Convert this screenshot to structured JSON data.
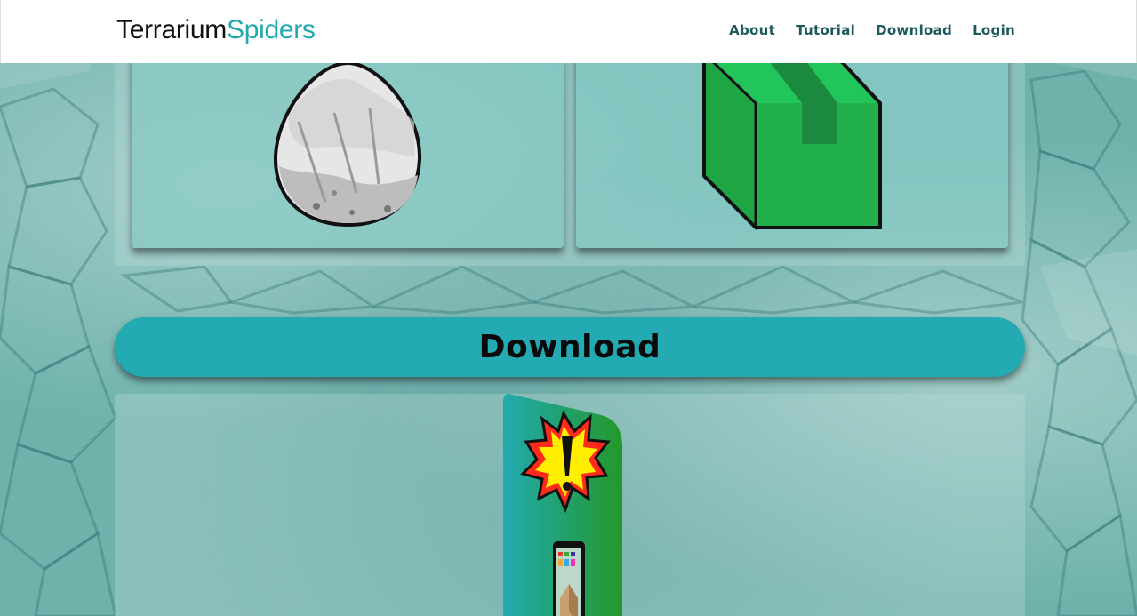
{
  "header": {
    "brand_part1": "Terrarium",
    "brand_part2": "Spiders",
    "nav": [
      {
        "label": "About"
      },
      {
        "label": "Tutorial"
      },
      {
        "label": "Download"
      },
      {
        "label": "Login"
      }
    ]
  },
  "cards": [
    {
      "icon": "egg-icon"
    },
    {
      "icon": "box-icon"
    }
  ],
  "download_section": {
    "heading": "Download"
  },
  "colors": {
    "brand_accent": "#22a8b0",
    "nav_text": "#1d5a5c",
    "download_bar": "#23aab2",
    "box_green": "#22b24c"
  }
}
